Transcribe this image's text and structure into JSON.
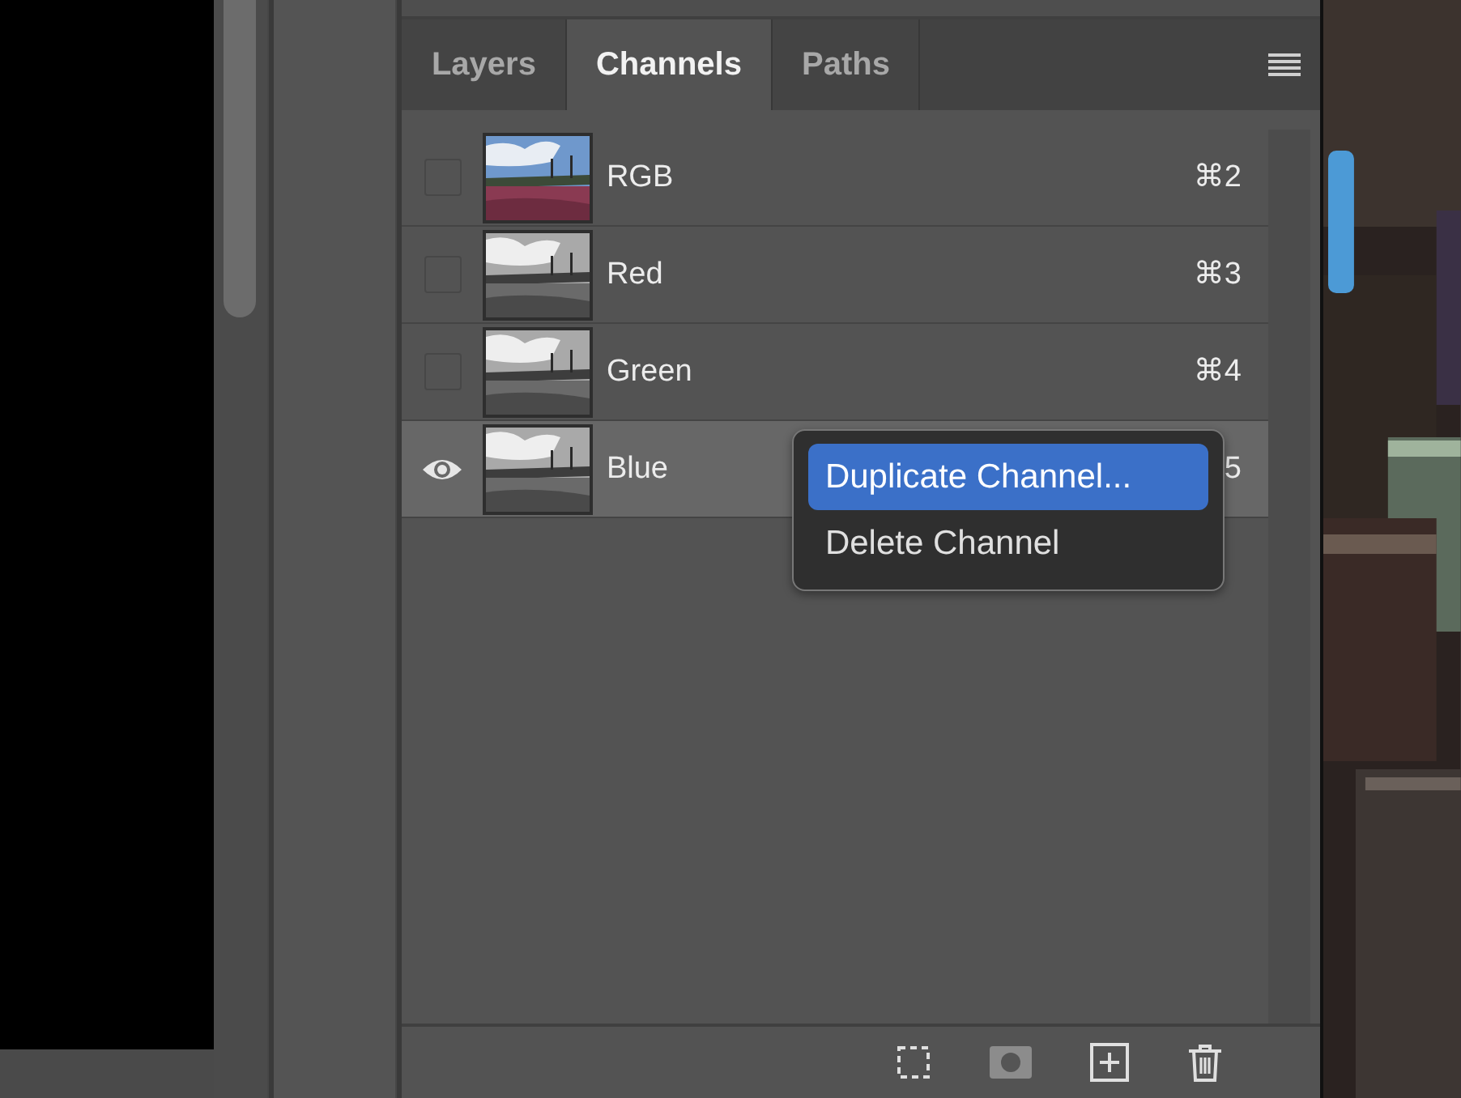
{
  "panel": {
    "tabs": [
      {
        "label": "Layers",
        "selected": false
      },
      {
        "label": "Channels",
        "selected": true
      },
      {
        "label": "Paths",
        "selected": false
      }
    ],
    "channels": [
      {
        "name": "RGB",
        "shortcut": "⌘2",
        "visible": false,
        "selected": false,
        "kind": "color"
      },
      {
        "name": "Red",
        "shortcut": "⌘3",
        "visible": false,
        "selected": false,
        "kind": "grayscale"
      },
      {
        "name": "Green",
        "shortcut": "⌘4",
        "visible": false,
        "selected": false,
        "kind": "grayscale"
      },
      {
        "name": "Blue",
        "shortcut": "5",
        "visible": true,
        "selected": true,
        "kind": "grayscale"
      }
    ]
  },
  "context_menu": {
    "items": [
      {
        "label": "Duplicate Channel...",
        "selected": true
      },
      {
        "label": "Delete Channel",
        "selected": false
      }
    ]
  }
}
